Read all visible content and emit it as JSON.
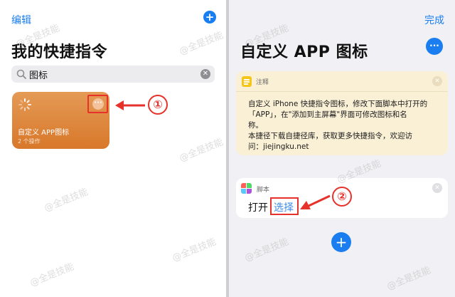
{
  "left": {
    "edit_label": "编辑",
    "add_symbol": "+",
    "title": "我的快捷指令",
    "search": {
      "value": "图标"
    },
    "shortcut": {
      "title": "自定义 APP图标",
      "subtitle": "2 个操作"
    },
    "more_symbol": "···",
    "step_label": "①"
  },
  "right": {
    "done_label": "完成",
    "title": "自定义 APP 图标",
    "more_symbol": "···",
    "note": {
      "label": "注释",
      "lines": [
        "自定义 iPhone 快捷指令图标，修改下面脚本中打开的",
        "「APP」，在\"添加到主屏幕\"界面可修改图标和名",
        "称。",
        "本捷径下载自捷径库，获取更多快捷指令，欢迎访",
        "问：jiejingku.net"
      ]
    },
    "script": {
      "label": "脚本",
      "open_text": "打开",
      "choose_text": "选择"
    },
    "add_symbol": "+",
    "step_label": "②"
  },
  "watermark": "@全是技能",
  "colors": {
    "accent": "#1a7ef0",
    "card_orange": "#de8a3f",
    "annotation_red": "#e6322a",
    "note_bg": "#faf0d6"
  }
}
